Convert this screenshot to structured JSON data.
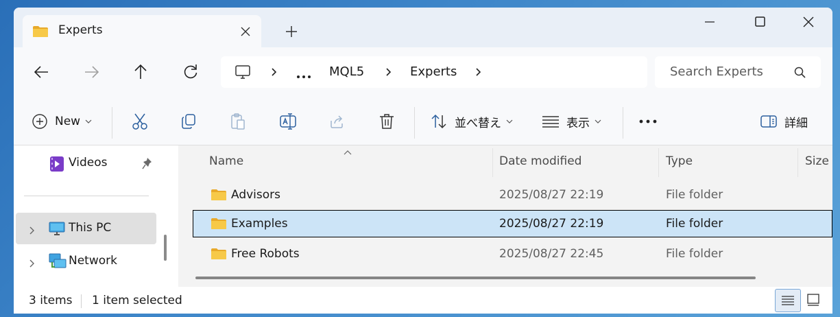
{
  "tab": {
    "title": "Experts"
  },
  "address": {
    "crumbs": [
      "MQL5",
      "Experts"
    ]
  },
  "search": {
    "placeholder": "Search Experts"
  },
  "commands": {
    "new_label": "New",
    "sort_label": "並べ替え",
    "view_label": "表示",
    "details_label": "詳細"
  },
  "sidebar": {
    "items": [
      {
        "label": "Videos"
      },
      {
        "label": "This PC"
      },
      {
        "label": "Network"
      }
    ]
  },
  "columns": {
    "name": "Name",
    "date": "Date modified",
    "type": "Type",
    "size": "Size"
  },
  "files": [
    {
      "name": "Advisors",
      "date": "2025/08/27 22:19",
      "type": "File folder"
    },
    {
      "name": "Examples",
      "date": "2025/08/27 22:19",
      "type": "File folder"
    },
    {
      "name": "Free Robots",
      "date": "2025/08/27 22:45",
      "type": "File folder"
    }
  ],
  "status": {
    "count": "3 items",
    "selection": "1 item selected"
  },
  "colors": {
    "selection": "#cce4f7",
    "folder": "#f4c542",
    "accent": "#0067c0"
  }
}
